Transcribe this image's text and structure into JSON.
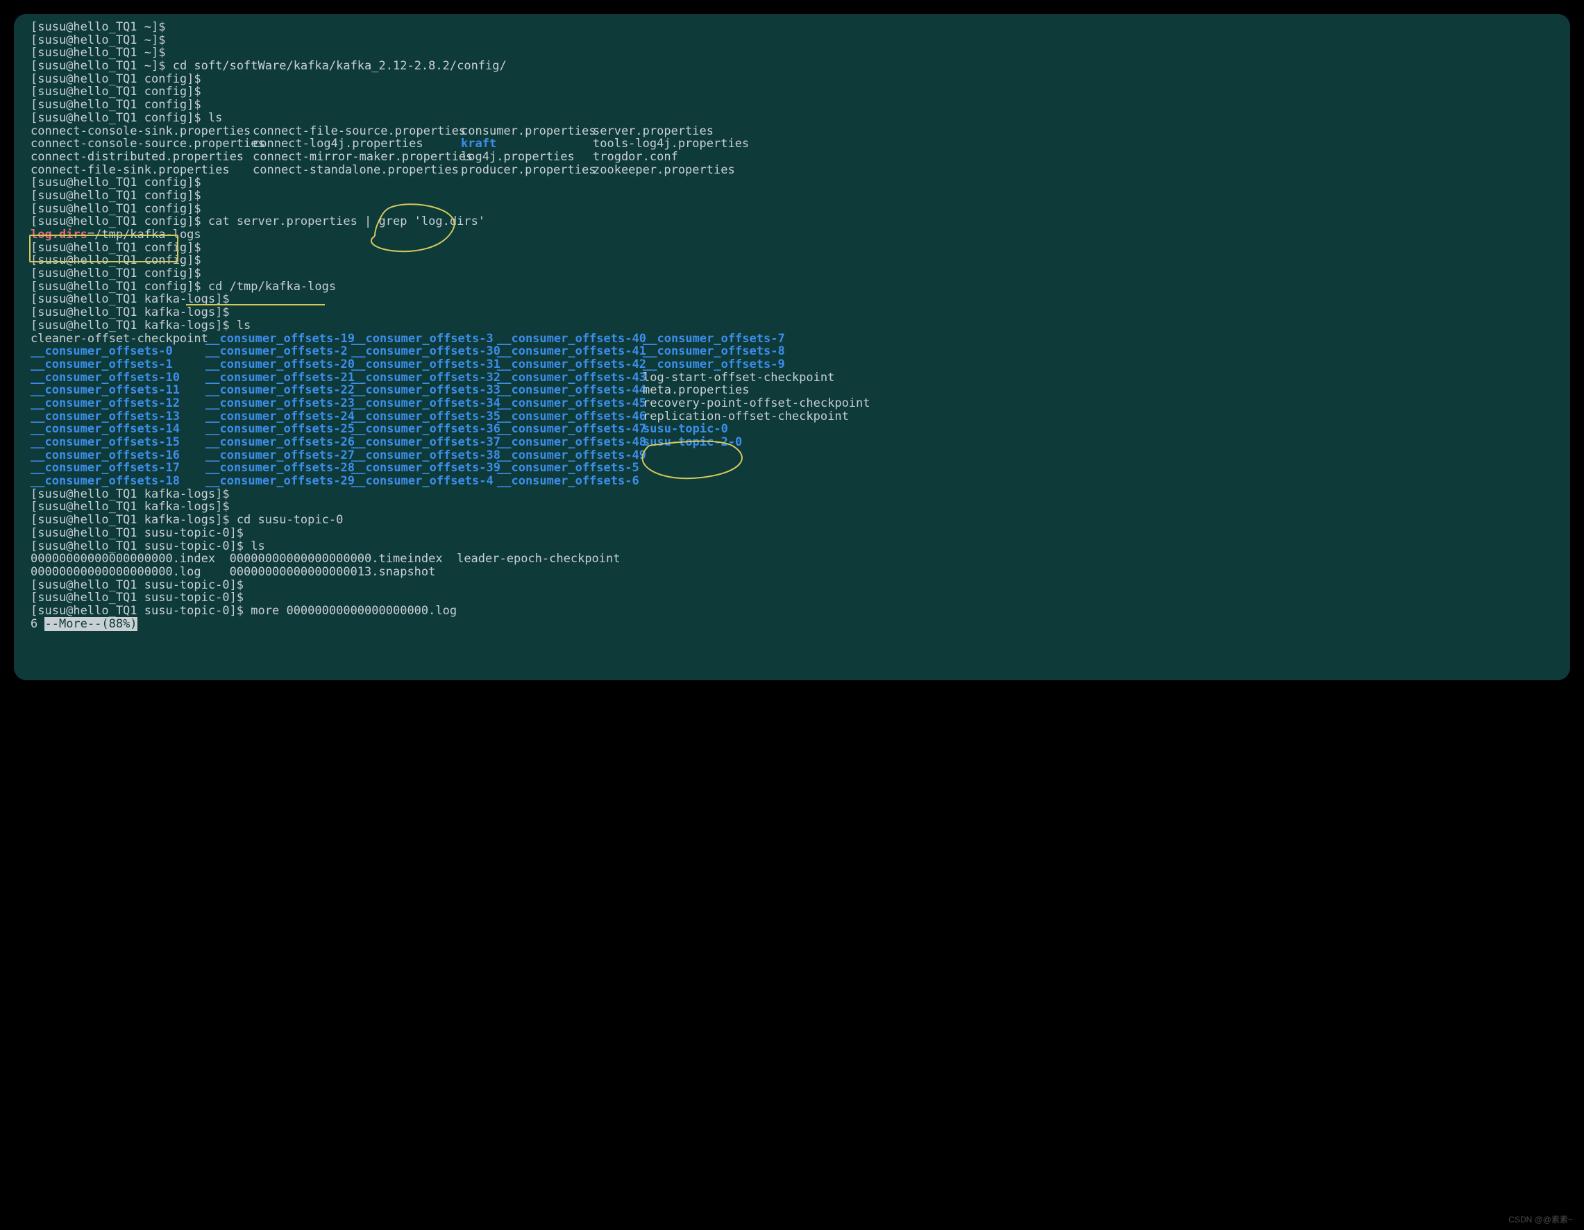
{
  "watermark": "CSDN @@素素~",
  "lines": [
    {
      "type": "prompt",
      "prefix": "[susu@hello_TQ1 ~]$",
      "cmd": "",
      "dim": true
    },
    {
      "type": "prompt",
      "prefix": "[susu@hello_TQ1 ~]$",
      "cmd": ""
    },
    {
      "type": "prompt",
      "prefix": "[susu@hello_TQ1 ~]$",
      "cmd": ""
    },
    {
      "type": "prompt",
      "prefix": "[susu@hello_TQ1 ~]$",
      "cmd": " cd soft/softWare/kafka/kafka_2.12-2.8.2/config/"
    },
    {
      "type": "prompt",
      "prefix": "[susu@hello_TQ1 config]$",
      "cmd": ""
    },
    {
      "type": "prompt",
      "prefix": "[susu@hello_TQ1 config]$",
      "cmd": ""
    },
    {
      "type": "prompt",
      "prefix": "[susu@hello_TQ1 config]$",
      "cmd": ""
    },
    {
      "type": "prompt",
      "prefix": "[susu@hello_TQ1 config]$",
      "cmd": " ls"
    },
    {
      "type": "ls-config"
    },
    {
      "type": "prompt",
      "prefix": "[susu@hello_TQ1 config]$",
      "cmd": ""
    },
    {
      "type": "prompt",
      "prefix": "[susu@hello_TQ1 config]$",
      "cmd": ""
    },
    {
      "type": "prompt",
      "prefix": "[susu@hello_TQ1 config]$",
      "cmd": ""
    },
    {
      "type": "grep",
      "prefix": "[susu@hello_TQ1 config]$",
      "cmd": " cat server.properties | grep 'log.dirs'"
    },
    {
      "type": "grep-out",
      "key": "log.dirs",
      "val": "=/tmp/kafka-logs"
    },
    {
      "type": "prompt",
      "prefix": "[susu@hello_TQ1 config]$",
      "cmd": ""
    },
    {
      "type": "prompt",
      "prefix": "[susu@hello_TQ1 config]$",
      "cmd": ""
    },
    {
      "type": "prompt",
      "prefix": "[susu@hello_TQ1 config]$",
      "cmd": ""
    },
    {
      "type": "prompt",
      "prefix": "[susu@hello_TQ1 config]$",
      "cmd": " cd /tmp/kafka-logs"
    },
    {
      "type": "prompt",
      "prefix": "[susu@hello_TQ1 kafka-logs]$",
      "cmd": ""
    },
    {
      "type": "prompt",
      "prefix": "[susu@hello_TQ1 kafka-logs]$",
      "cmd": ""
    },
    {
      "type": "prompt",
      "prefix": "[susu@hello_TQ1 kafka-logs]$",
      "cmd": " ls"
    },
    {
      "type": "ls-logs"
    },
    {
      "type": "prompt",
      "prefix": "[susu@hello_TQ1 kafka-logs]$",
      "cmd": ""
    },
    {
      "type": "prompt",
      "prefix": "[susu@hello_TQ1 kafka-logs]$",
      "cmd": ""
    },
    {
      "type": "prompt",
      "prefix": "[susu@hello_TQ1 kafka-logs]$",
      "cmd": " cd susu-topic-0"
    },
    {
      "type": "prompt",
      "prefix": "[susu@hello_TQ1 susu-topic-0]$",
      "cmd": ""
    },
    {
      "type": "prompt",
      "prefix": "[susu@hello_TQ1 susu-topic-0]$",
      "cmd": " ls"
    },
    {
      "type": "ls-topic"
    },
    {
      "type": "prompt",
      "prefix": "[susu@hello_TQ1 susu-topic-0]$",
      "cmd": ""
    },
    {
      "type": "prompt",
      "prefix": "[susu@hello_TQ1 susu-topic-0]$",
      "cmd": ""
    },
    {
      "type": "prompt",
      "prefix": "[susu@hello_TQ1 susu-topic-0]$",
      "cmd": " more 00000000000000000000.log"
    },
    {
      "type": "more",
      "prefix": "6 ",
      "pager": "--More--(88%)"
    }
  ],
  "ls_config": [
    [
      "connect-console-sink.properties",
      "connect-file-source.properties",
      "consumer.properties",
      "server.properties"
    ],
    [
      "connect-console-source.properties",
      "connect-log4j.properties",
      "kraft",
      "tools-log4j.properties"
    ],
    [
      "connect-distributed.properties",
      "connect-mirror-maker.properties",
      "log4j.properties",
      "trogdor.conf"
    ],
    [
      "connect-file-sink.properties",
      "connect-standalone.properties",
      "producer.properties",
      "zookeeper.properties"
    ]
  ],
  "ls_config_dir": "kraft",
  "ls_logs_rows": [
    [
      {
        "t": "cleaner-offset-checkpoint",
        "c": "f"
      },
      {
        "t": "__consumer_offsets-19",
        "c": "d"
      },
      {
        "t": "__consumer_offsets-3",
        "c": "d"
      },
      {
        "t": "__consumer_offsets-40",
        "c": "d"
      },
      {
        "t": "__consumer_offsets-7",
        "c": "d"
      }
    ],
    [
      {
        "t": "__consumer_offsets-0",
        "c": "d"
      },
      {
        "t": "__consumer_offsets-2",
        "c": "d"
      },
      {
        "t": "__consumer_offsets-30",
        "c": "d"
      },
      {
        "t": "__consumer_offsets-41",
        "c": "d"
      },
      {
        "t": "__consumer_offsets-8",
        "c": "d"
      }
    ],
    [
      {
        "t": "__consumer_offsets-1",
        "c": "d"
      },
      {
        "t": "__consumer_offsets-20",
        "c": "d"
      },
      {
        "t": "__consumer_offsets-31",
        "c": "d"
      },
      {
        "t": "__consumer_offsets-42",
        "c": "d"
      },
      {
        "t": "__consumer_offsets-9",
        "c": "d"
      }
    ],
    [
      {
        "t": "__consumer_offsets-10",
        "c": "d"
      },
      {
        "t": "__consumer_offsets-21",
        "c": "d"
      },
      {
        "t": "__consumer_offsets-32",
        "c": "d"
      },
      {
        "t": "__consumer_offsets-43",
        "c": "d"
      },
      {
        "t": "log-start-offset-checkpoint",
        "c": "f"
      }
    ],
    [
      {
        "t": "__consumer_offsets-11",
        "c": "d"
      },
      {
        "t": "__consumer_offsets-22",
        "c": "d"
      },
      {
        "t": "__consumer_offsets-33",
        "c": "d"
      },
      {
        "t": "__consumer_offsets-44",
        "c": "d"
      },
      {
        "t": "meta.properties",
        "c": "f"
      }
    ],
    [
      {
        "t": "__consumer_offsets-12",
        "c": "d"
      },
      {
        "t": "__consumer_offsets-23",
        "c": "d"
      },
      {
        "t": "__consumer_offsets-34",
        "c": "d"
      },
      {
        "t": "__consumer_offsets-45",
        "c": "d"
      },
      {
        "t": "recovery-point-offset-checkpoint",
        "c": "f"
      }
    ],
    [
      {
        "t": "__consumer_offsets-13",
        "c": "d"
      },
      {
        "t": "__consumer_offsets-24",
        "c": "d"
      },
      {
        "t": "__consumer_offsets-35",
        "c": "d"
      },
      {
        "t": "__consumer_offsets-46",
        "c": "d"
      },
      {
        "t": "replication-offset-checkpoint",
        "c": "f"
      }
    ],
    [
      {
        "t": "__consumer_offsets-14",
        "c": "d"
      },
      {
        "t": "__consumer_offsets-25",
        "c": "d"
      },
      {
        "t": "__consumer_offsets-36",
        "c": "d"
      },
      {
        "t": "__consumer_offsets-47",
        "c": "d"
      },
      {
        "t": "susu-topic-0",
        "c": "d"
      }
    ],
    [
      {
        "t": "__consumer_offsets-15",
        "c": "d"
      },
      {
        "t": "__consumer_offsets-26",
        "c": "d"
      },
      {
        "t": "__consumer_offsets-37",
        "c": "d"
      },
      {
        "t": "__consumer_offsets-48",
        "c": "d"
      },
      {
        "t": "susu-topic-2-0",
        "c": "d"
      }
    ],
    [
      {
        "t": "__consumer_offsets-16",
        "c": "d"
      },
      {
        "t": "__consumer_offsets-27",
        "c": "d"
      },
      {
        "t": "__consumer_offsets-38",
        "c": "d"
      },
      {
        "t": "__consumer_offsets-49",
        "c": "d"
      },
      {
        "t": "",
        "c": "f"
      }
    ],
    [
      {
        "t": "__consumer_offsets-17",
        "c": "d"
      },
      {
        "t": "__consumer_offsets-28",
        "c": "d"
      },
      {
        "t": "__consumer_offsets-39",
        "c": "d"
      },
      {
        "t": "__consumer_offsets-5",
        "c": "d"
      },
      {
        "t": "",
        "c": "f"
      }
    ],
    [
      {
        "t": "__consumer_offsets-18",
        "c": "d"
      },
      {
        "t": "__consumer_offsets-29",
        "c": "d"
      },
      {
        "t": "__consumer_offsets-4",
        "c": "d"
      },
      {
        "t": "__consumer_offsets-6",
        "c": "d"
      },
      {
        "t": "",
        "c": "f"
      }
    ]
  ],
  "ls_topic_rows": [
    [
      "00000000000000000000.index",
      "00000000000000000000.timeindex",
      "leader-epoch-checkpoint"
    ],
    [
      "00000000000000000000.log",
      "00000000000000000013.snapshot",
      ""
    ]
  ]
}
